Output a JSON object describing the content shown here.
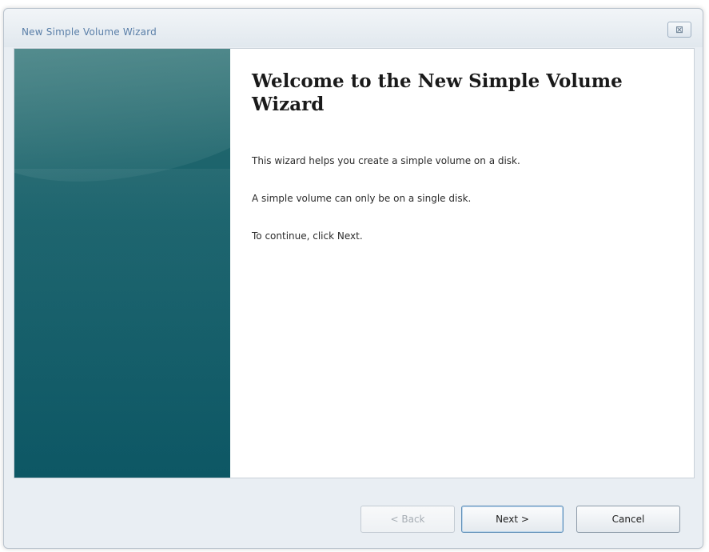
{
  "window": {
    "title": "New Simple Volume Wizard",
    "close_label": "⊠"
  },
  "wizard": {
    "heading": "Welcome to the New Simple Volume Wizard",
    "paragraphs": [
      "This wizard helps you create a simple volume on a disk.",
      "A simple volume can only be on a single disk.",
      "To continue, click Next."
    ],
    "banner_color": "#15606a"
  },
  "buttons": {
    "back_label": "< Back",
    "next_label": "Next >",
    "cancel_label": "Cancel",
    "back_enabled": false
  }
}
